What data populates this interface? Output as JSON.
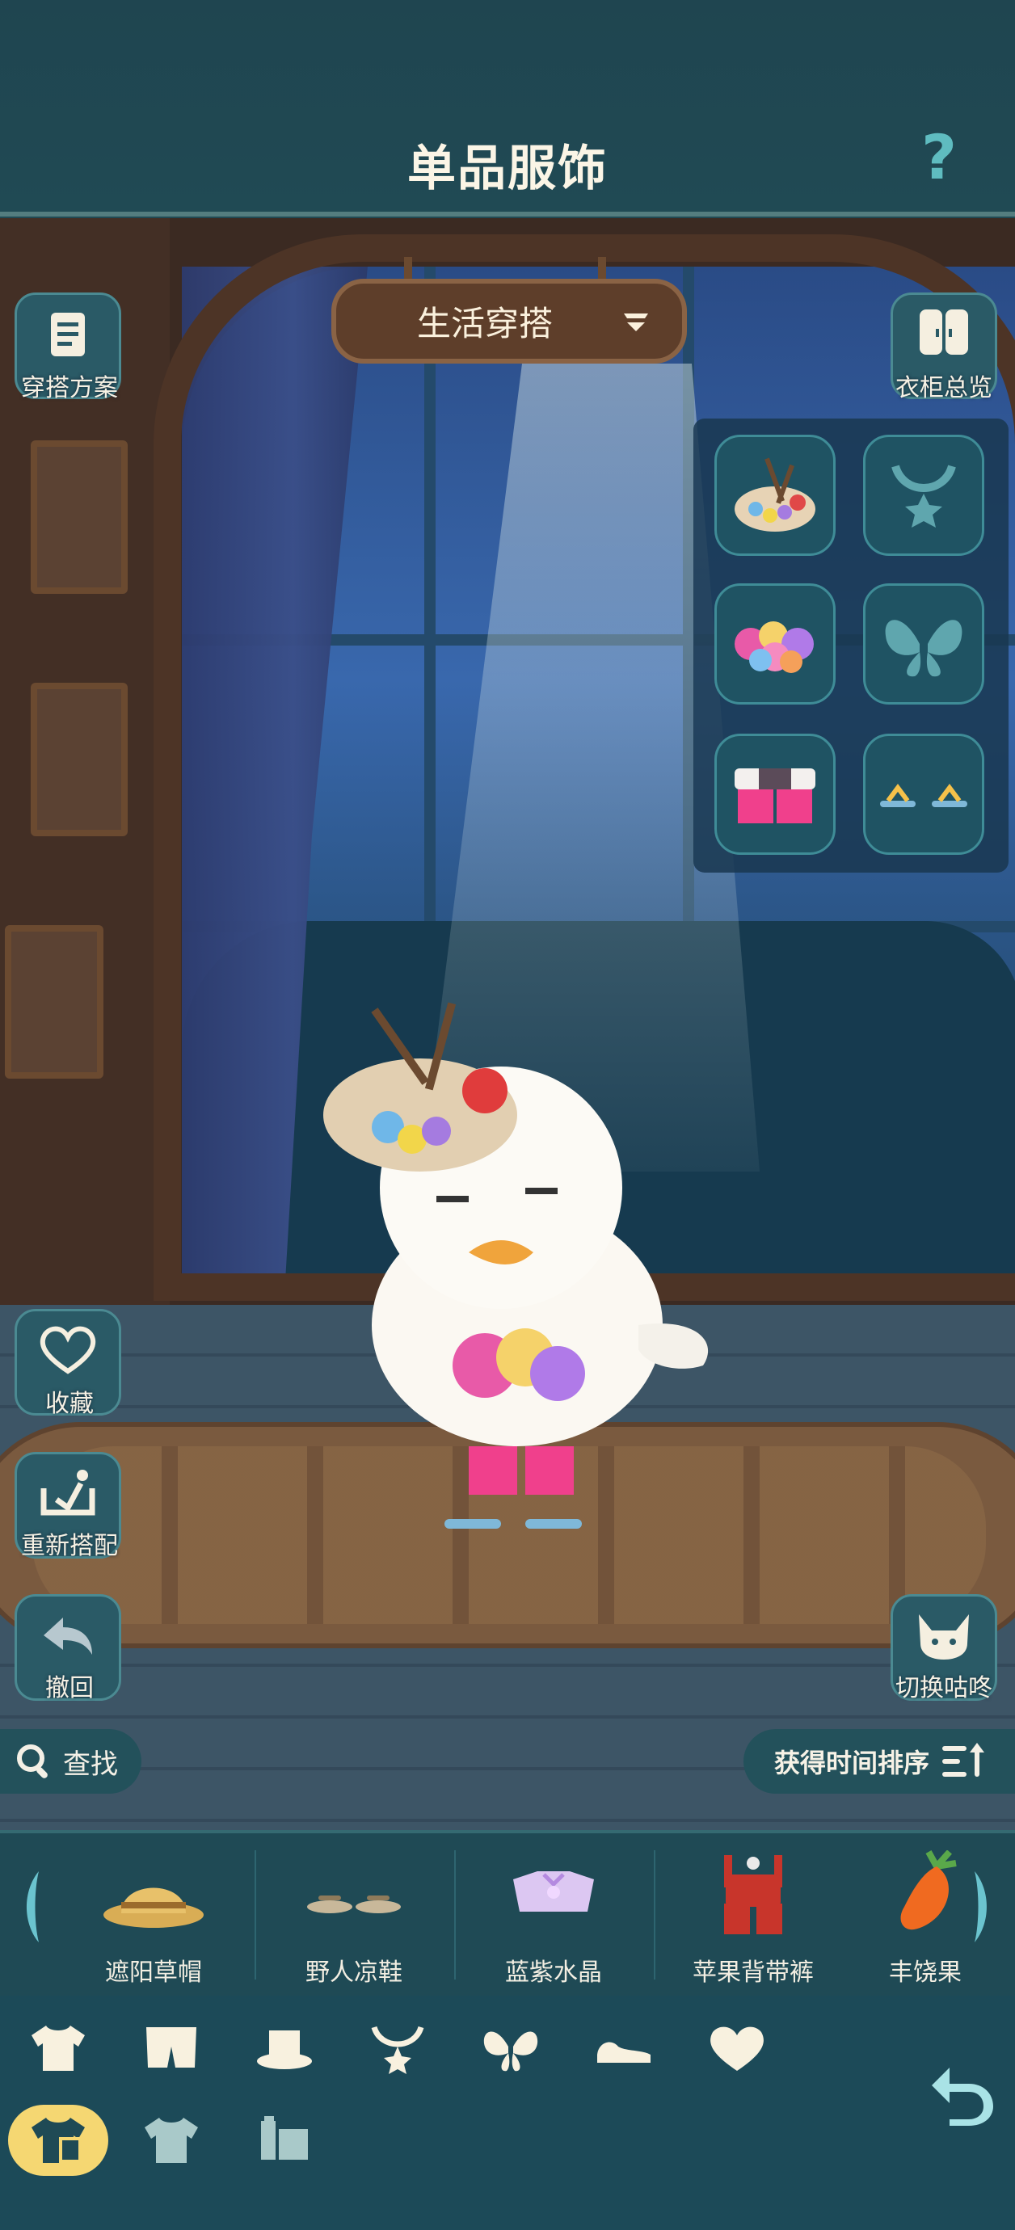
{
  "header": {
    "title": "单品服饰",
    "help_icon": "question-icon"
  },
  "sign": {
    "label": "生活穿搭",
    "icon": "dropdown-icon"
  },
  "left_buttons": [
    {
      "label": "穿搭方案",
      "icon": "outfit-plan-icon"
    },
    {
      "label": "收藏",
      "icon": "heart-icon"
    },
    {
      "label": "重新搭配",
      "icon": "redress-icon"
    },
    {
      "label": "撤回",
      "icon": "undo-icon"
    }
  ],
  "right_buttons": [
    {
      "label": "衣柜总览",
      "icon": "wardrobe-icon"
    },
    {
      "label": "切换咕咚",
      "icon": "switch-character-icon"
    }
  ],
  "equipped_slots": [
    {
      "icon": "palette-hat-icon",
      "filled": true
    },
    {
      "icon": "necklace-icon",
      "filled": false
    },
    {
      "icon": "flower-top-icon",
      "filled": true
    },
    {
      "icon": "wings-icon",
      "filled": false
    },
    {
      "icon": "pink-shorts-icon",
      "filled": true
    },
    {
      "icon": "sandals-icon",
      "filled": true
    }
  ],
  "search": {
    "label": "查找",
    "icon": "search-icon"
  },
  "sort": {
    "label": "获得时间排序",
    "icon": "sort-icon"
  },
  "items": [
    {
      "label": "遮阳草帽",
      "icon": "straw-hat-icon"
    },
    {
      "label": "野人凉鞋",
      "icon": "sandals-icon"
    },
    {
      "label": "蓝紫水晶",
      "icon": "crystal-top-icon"
    },
    {
      "label": "苹果背带裤",
      "icon": "overalls-icon"
    },
    {
      "label": "丰饶果",
      "icon": "carrot-icon"
    }
  ],
  "categories": [
    "shirt-icon",
    "pants-icon",
    "hat-icon",
    "necklace-icon",
    "wings-icon",
    "shoes-icon",
    "heart-icon"
  ],
  "sub_categories": [
    "all-clothes-icon",
    "set-icon",
    "accessory-icon"
  ],
  "colors": {
    "accent": "#5fbcc0",
    "selected": "#f5d772",
    "text": "#fbf5e6"
  }
}
